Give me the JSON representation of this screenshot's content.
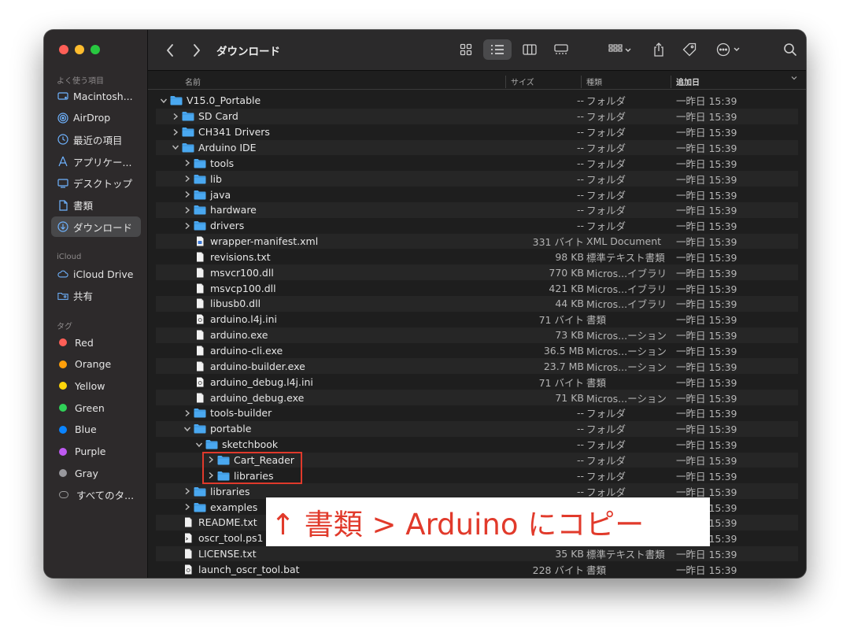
{
  "window": {
    "title": "ダウンロード"
  },
  "sidebar": {
    "favorites_label": "よく使う項目",
    "favorites": [
      {
        "label": "Macintosh...",
        "icon": "disk-icon"
      },
      {
        "label": "AirDrop",
        "icon": "airdrop-icon"
      },
      {
        "label": "最近の項目",
        "icon": "clock-icon"
      },
      {
        "label": "アプリケー...",
        "icon": "applications-icon"
      },
      {
        "label": "デスクトップ",
        "icon": "desktop-icon"
      },
      {
        "label": "書類",
        "icon": "document-icon"
      },
      {
        "label": "ダウンロード",
        "icon": "download-icon",
        "active": true
      }
    ],
    "icloud_label": "iCloud",
    "icloud": [
      {
        "label": "iCloud Drive",
        "icon": "cloud-icon"
      },
      {
        "label": "共有",
        "icon": "shared-folder-icon"
      }
    ],
    "tags_label": "タグ",
    "tags": [
      {
        "label": "Red",
        "color": "#ff5f57"
      },
      {
        "label": "Orange",
        "color": "#ff9f0a"
      },
      {
        "label": "Yellow",
        "color": "#ffd60a"
      },
      {
        "label": "Green",
        "color": "#30d158"
      },
      {
        "label": "Blue",
        "color": "#0a84ff"
      },
      {
        "label": "Purple",
        "color": "#bf5af2"
      },
      {
        "label": "Gray",
        "color": "#98989d"
      },
      {
        "label": "すべてのタ...",
        "color": null
      }
    ]
  },
  "columns": {
    "name": "名前",
    "size": "サイズ",
    "kind": "種類",
    "date": "追加日"
  },
  "files": [
    {
      "name": "V15.0_Portable",
      "depth": 0,
      "type": "folder",
      "expanded": true,
      "size": "--",
      "kind": "フォルダ",
      "date": "一昨日 15:39"
    },
    {
      "name": "SD Card",
      "depth": 1,
      "type": "folder",
      "expanded": false,
      "size": "--",
      "kind": "フォルダ",
      "date": "一昨日 15:39"
    },
    {
      "name": "CH341 Drivers",
      "depth": 1,
      "type": "folder",
      "expanded": false,
      "size": "--",
      "kind": "フォルダ",
      "date": "一昨日 15:39"
    },
    {
      "name": "Arduino IDE",
      "depth": 1,
      "type": "folder",
      "expanded": true,
      "size": "--",
      "kind": "フォルダ",
      "date": "一昨日 15:39"
    },
    {
      "name": "tools",
      "depth": 2,
      "type": "folder",
      "expanded": false,
      "size": "--",
      "kind": "フォルダ",
      "date": "一昨日 15:39"
    },
    {
      "name": "lib",
      "depth": 2,
      "type": "folder",
      "expanded": false,
      "size": "--",
      "kind": "フォルダ",
      "date": "一昨日 15:39"
    },
    {
      "name": "java",
      "depth": 2,
      "type": "folder",
      "expanded": false,
      "size": "--",
      "kind": "フォルダ",
      "date": "一昨日 15:39"
    },
    {
      "name": "hardware",
      "depth": 2,
      "type": "folder",
      "expanded": false,
      "size": "--",
      "kind": "フォルダ",
      "date": "一昨日 15:39"
    },
    {
      "name": "drivers",
      "depth": 2,
      "type": "folder",
      "expanded": false,
      "size": "--",
      "kind": "フォルダ",
      "date": "一昨日 15:39"
    },
    {
      "name": "wrapper-manifest.xml",
      "depth": 2,
      "type": "xml",
      "size": "331 バイト",
      "kind": "XML Document",
      "date": "一昨日 15:39"
    },
    {
      "name": "revisions.txt",
      "depth": 2,
      "type": "file",
      "size": "98 KB",
      "kind": "標準テキスト書類",
      "date": "一昨日 15:39"
    },
    {
      "name": "msvcr100.dll",
      "depth": 2,
      "type": "file",
      "size": "770 KB",
      "kind": "Micros...イブラリ",
      "date": "一昨日 15:39"
    },
    {
      "name": "msvcp100.dll",
      "depth": 2,
      "type": "file",
      "size": "421 KB",
      "kind": "Micros...イブラリ",
      "date": "一昨日 15:39"
    },
    {
      "name": "libusb0.dll",
      "depth": 2,
      "type": "file",
      "size": "44 KB",
      "kind": "Micros...イブラリ",
      "date": "一昨日 15:39"
    },
    {
      "name": "arduino.l4j.ini",
      "depth": 2,
      "type": "gear",
      "size": "71 バイト",
      "kind": "書類",
      "date": "一昨日 15:39"
    },
    {
      "name": "arduino.exe",
      "depth": 2,
      "type": "file",
      "size": "73 KB",
      "kind": "Micros...ーション",
      "date": "一昨日 15:39"
    },
    {
      "name": "arduino-cli.exe",
      "depth": 2,
      "type": "file",
      "size": "36.5 MB",
      "kind": "Micros...ーション",
      "date": "一昨日 15:39"
    },
    {
      "name": "arduino-builder.exe",
      "depth": 2,
      "type": "file",
      "size": "23.7 MB",
      "kind": "Micros...ーション",
      "date": "一昨日 15:39"
    },
    {
      "name": "arduino_debug.l4j.ini",
      "depth": 2,
      "type": "gear",
      "size": "71 バイト",
      "kind": "書類",
      "date": "一昨日 15:39"
    },
    {
      "name": "arduino_debug.exe",
      "depth": 2,
      "type": "file",
      "size": "71 KB",
      "kind": "Micros...ーション",
      "date": "一昨日 15:39"
    },
    {
      "name": "tools-builder",
      "depth": 2,
      "type": "folder",
      "expanded": false,
      "size": "--",
      "kind": "フォルダ",
      "date": "一昨日 15:39"
    },
    {
      "name": "portable",
      "depth": 2,
      "type": "folder",
      "expanded": true,
      "size": "--",
      "kind": "フォルダ",
      "date": "一昨日 15:39"
    },
    {
      "name": "sketchbook",
      "depth": 3,
      "type": "folder",
      "expanded": true,
      "size": "--",
      "kind": "フォルダ",
      "date": "一昨日 15:39"
    },
    {
      "name": "Cart_Reader",
      "depth": 4,
      "type": "folder",
      "expanded": false,
      "size": "--",
      "kind": "フォルダ",
      "date": "一昨日 15:39"
    },
    {
      "name": "libraries",
      "depth": 4,
      "type": "folder",
      "expanded": false,
      "size": "--",
      "kind": "フォルダ",
      "date": "一昨日 15:39"
    },
    {
      "name": "libraries",
      "depth": 2,
      "type": "folder",
      "expanded": false,
      "size": "--",
      "kind": "フォルダ",
      "date": "一昨日 15:39"
    },
    {
      "name": "examples",
      "depth": 2,
      "type": "folder",
      "expanded": false,
      "size": "--",
      "kind": "フォルダ",
      "date": "一昨日 15:39"
    },
    {
      "name": "README.txt",
      "depth": 1,
      "type": "file",
      "size": "",
      "kind": "",
      "date": "一昨日 15:39"
    },
    {
      "name": "oscr_tool.ps1",
      "depth": 1,
      "type": "terminal",
      "size": "",
      "kind": "",
      "date": "一昨日 15:39"
    },
    {
      "name": "LICENSE.txt",
      "depth": 1,
      "type": "file",
      "size": "35 KB",
      "kind": "標準テキスト書類",
      "date": "一昨日 15:39"
    },
    {
      "name": "launch_oscr_tool.bat",
      "depth": 1,
      "type": "gear",
      "size": "228 バイト",
      "kind": "書類",
      "date": "一昨日 15:39"
    }
  ],
  "annotation": {
    "text": "↑ 書類 > Arduino にコピー",
    "color": "#e13a2b"
  },
  "colors": {
    "folder": "#4aa8f0",
    "accent": "#0a84ff"
  }
}
